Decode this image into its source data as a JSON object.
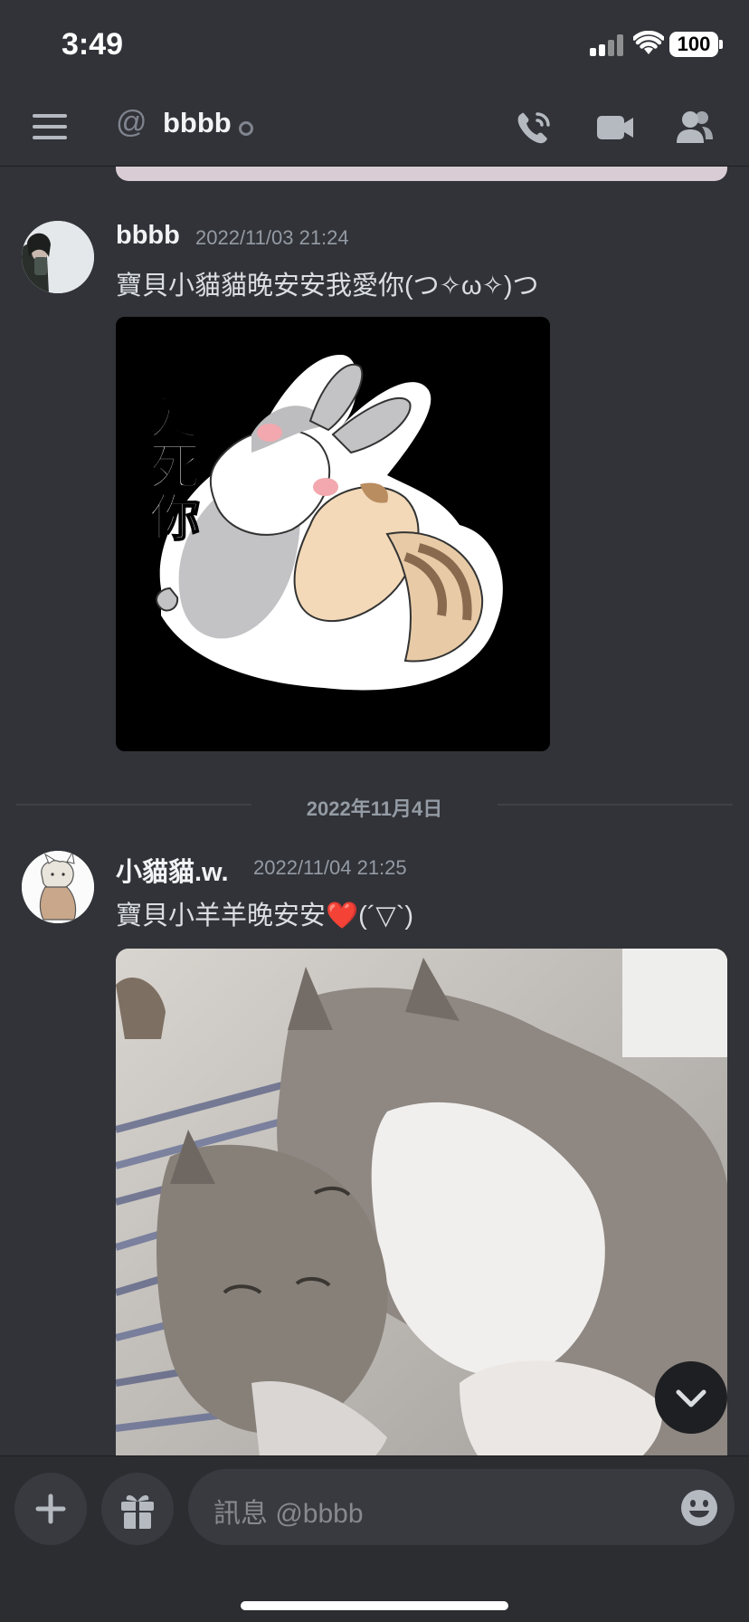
{
  "status_bar": {
    "time": "3:49",
    "battery": "100"
  },
  "header": {
    "at_symbol": "@",
    "channel_name": "bbbb"
  },
  "messages": [
    {
      "username": "bbbb",
      "timestamp": "2022/11/03 21:24",
      "text": "寶貝小貓貓晚安安我愛你(つ✧ω✧)つ",
      "sticker_text": "爱死你"
    },
    {
      "username": "小貓貓.w.",
      "timestamp": "2022/11/04 21:25",
      "text": "寶貝小羊羊晚安安❤️(´▽`)"
    }
  ],
  "date_divider": "2022年11月4日",
  "composer": {
    "placeholder": "訊息 @bbbb"
  },
  "colors": {
    "background": "#313338",
    "composer": "#2b2d31",
    "input": "#383a40",
    "muted": "#949ba4"
  }
}
